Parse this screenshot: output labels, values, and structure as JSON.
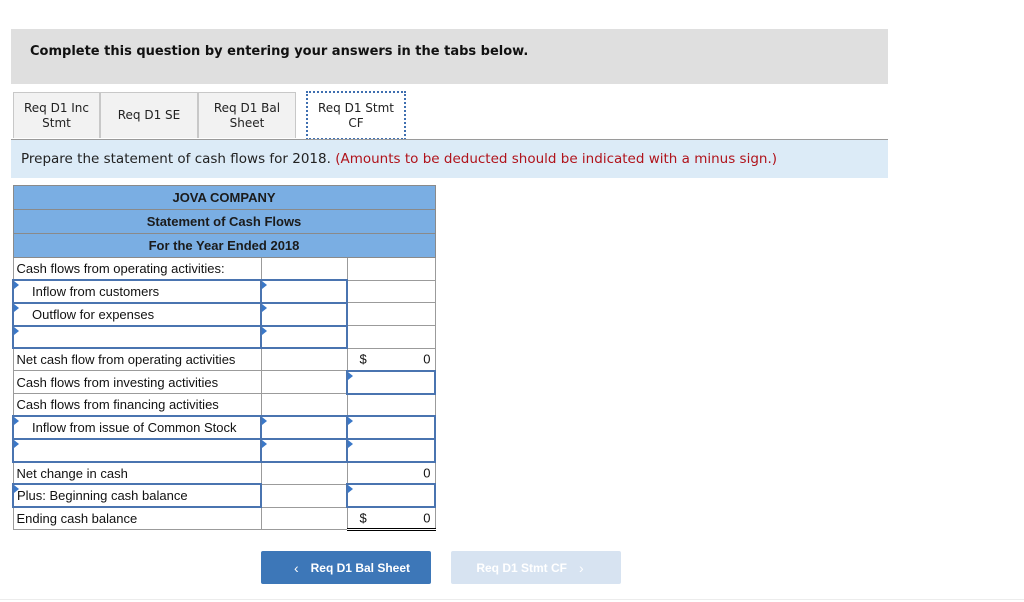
{
  "instruction": "Complete this question by entering your answers in the tabs below.",
  "tabs": [
    {
      "label_line1": "Req D1 Inc",
      "label_line2": "Stmt",
      "active": false
    },
    {
      "label_line1": "Req D1 SE",
      "label_line2": "",
      "active": false
    },
    {
      "label_line1": "Req D1 Bal",
      "label_line2": "Sheet",
      "active": false
    },
    {
      "label_line1": "Req D1 Stmt",
      "label_line2": "CF",
      "active": true
    }
  ],
  "prompt": {
    "text": "Prepare the statement of cash flows for 2018.",
    "note": "(Amounts to be deducted should be indicated with a minus sign.)"
  },
  "statement": {
    "company": "JOVA COMPANY",
    "title": "Statement of Cash Flows",
    "period": "For the Year Ended 2018",
    "rows": [
      {
        "label": "Cash flows from operating activities:",
        "amount1": "",
        "amount2": ""
      },
      {
        "label": "Inflow from customers",
        "amount1": "",
        "amount2": ""
      },
      {
        "label": "Outflow for expenses",
        "amount1": "",
        "amount2": ""
      },
      {
        "label": "",
        "amount1": "",
        "amount2": ""
      },
      {
        "label": "Net cash flow from operating activities",
        "currency": "$",
        "amount2": "0"
      },
      {
        "label": "Cash flows from investing activities",
        "amount2": ""
      },
      {
        "label": "Cash flows from financing activities",
        "amount2": ""
      },
      {
        "label": "Inflow from issue of Common Stock",
        "amount1": "",
        "amount2": ""
      },
      {
        "label": "",
        "amount1": "",
        "amount2": ""
      },
      {
        "label": "Net change in cash",
        "amount2": "0"
      },
      {
        "label": "Plus: Beginning cash balance",
        "amount2": ""
      },
      {
        "label": "Ending cash balance",
        "currency": "$",
        "amount2": "0"
      }
    ]
  },
  "nav": {
    "prev_label": "Req D1 Bal Sheet",
    "prev_icon": "‹",
    "next_label": "Req D1 Stmt CF",
    "next_icon": "›"
  }
}
